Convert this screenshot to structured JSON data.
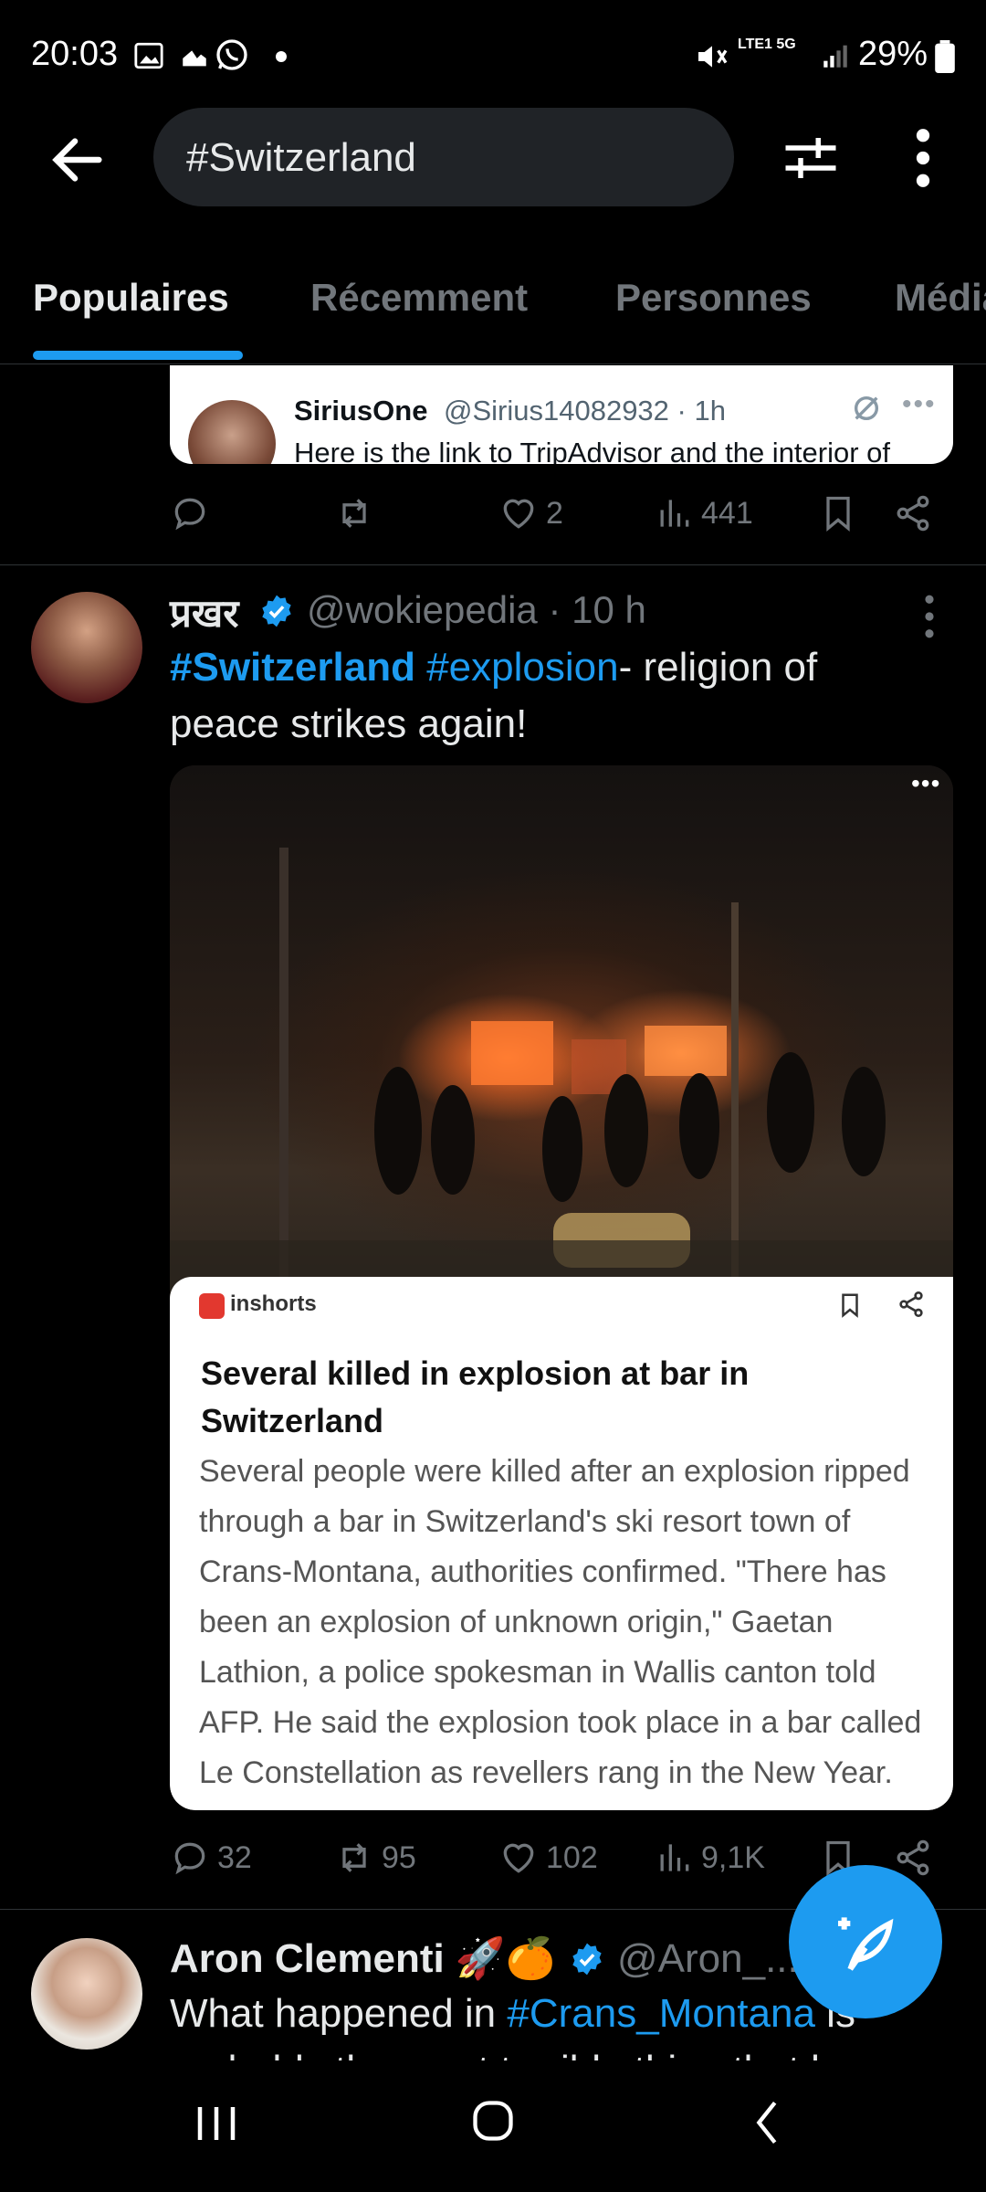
{
  "status_bar": {
    "time": "20:03",
    "battery": "29%",
    "network": "LTE1 5G"
  },
  "header": {
    "search_value": "#Switzerland"
  },
  "tabs": [
    {
      "label": "Populaires",
      "active": true
    },
    {
      "label": "Récemment",
      "active": false
    },
    {
      "label": "Personnes",
      "active": false
    },
    {
      "label": "Médias",
      "active": false
    }
  ],
  "quoted_tweet": {
    "name": "SiriusOne",
    "handle": "@Sirius14082932 · 1h",
    "text": "Here is the link to TripAdvisor and the interior of"
  },
  "tweet1_actions": {
    "replies": "",
    "retweets": "",
    "likes": "2",
    "views": "441"
  },
  "tweet2": {
    "name": "प्रखर",
    "handle": "@wokiepedia · 10 h",
    "hashtag1": "#Switzerland",
    "hashtag2": "#explosion",
    "text_rest": "- religion of peace strikes again!",
    "article": {
      "source": "inshorts",
      "title": "Several killed in explosion at bar in Switzerland",
      "summary": "Several people were killed after an explosion ripped through a bar in Switzerland's ski resort town of Crans-Montana, authorities confirmed. \"There has been an explosion of unknown origin,\" Gaetan Lathion, a police spokesman in Wallis canton told AFP. He said the explosion took place in a bar called Le Constellation as revellers rang in the New Year."
    },
    "actions": {
      "replies": "32",
      "retweets": "95",
      "likes": "102",
      "views": "9,1K"
    }
  },
  "tweet3": {
    "name": "Aron Clementi 🚀🍊",
    "handle": "@Aron_...",
    "text_before": "What happened in ",
    "hashtag": "#Crans_Montana",
    "text_after": " is probably the most terrible thing that has"
  },
  "colors": {
    "accent": "#1d9bf0",
    "background": "#000000",
    "text_secondary": "#71767b"
  }
}
